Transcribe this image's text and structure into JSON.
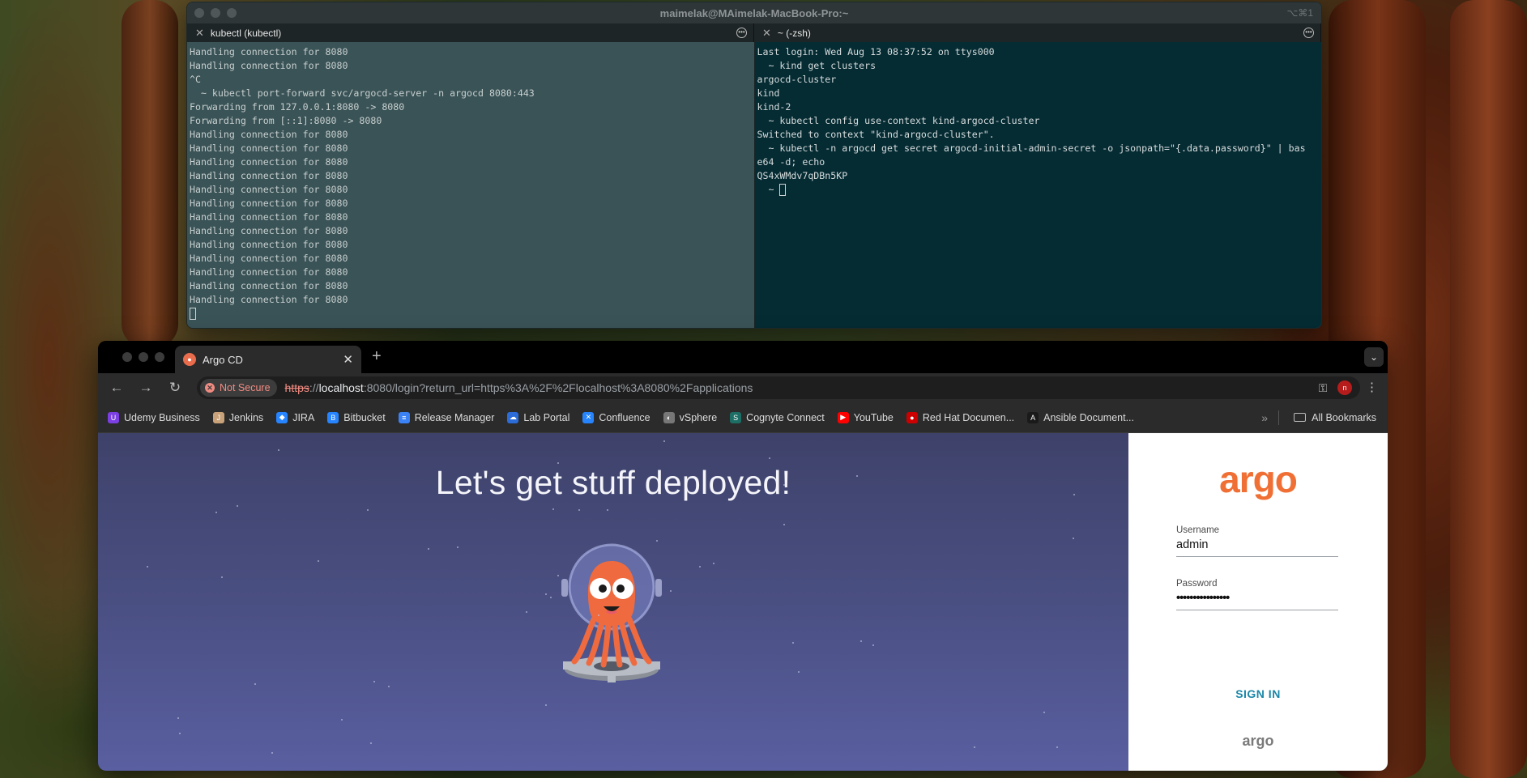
{
  "terminal": {
    "window_title": "maimelak@MAimelak-MacBook-Pro:~",
    "shortcut": "⌥⌘1",
    "tabs": [
      {
        "label": "kubectl (kubectl)"
      },
      {
        "label": "~ (-zsh)"
      }
    ],
    "left_lines": [
      "Handling connection for 8080",
      "Handling connection for 8080",
      "^C",
      "  ~ kubectl port-forward svc/argocd-server -n argocd 8080:443",
      "Forwarding from 127.0.0.1:8080 -> 8080",
      "Forwarding from [::1]:8080 -> 8080",
      "Handling connection for 8080",
      "Handling connection for 8080",
      "Handling connection for 8080",
      "Handling connection for 8080",
      "Handling connection for 8080",
      "Handling connection for 8080",
      "Handling connection for 8080",
      "Handling connection for 8080",
      "Handling connection for 8080",
      "Handling connection for 8080",
      "Handling connection for 8080",
      "Handling connection for 8080",
      "Handling connection for 8080"
    ],
    "right_lines": [
      "Last login: Wed Aug 13 08:37:52 on ttys000",
      "  ~ kind get clusters",
      "argocd-cluster",
      "kind",
      "kind-2",
      "  ~ kubectl config use-context kind-argocd-cluster",
      "Switched to context \"kind-argocd-cluster\".",
      "  ~ kubectl -n argocd get secret argocd-initial-admin-secret -o jsonpath=\"{.data.password}\" | bas",
      "e64 -d; echo",
      "QS4xWMdv7qDBn5KP",
      "  ~ "
    ]
  },
  "browser": {
    "tab_title": "Argo CD",
    "security_label": "Not Secure",
    "url_scheme": "https",
    "url_sep": "://",
    "url_host": "localhost",
    "url_rest": ":8080/login?return_url=https%3A%2F%2Flocalhost%3A8080%2Fapplications",
    "profile_initial": "n",
    "bookmarks": [
      {
        "label": "Udemy Business",
        "color": "#7b3fe4",
        "glyph": "U"
      },
      {
        "label": "Jenkins",
        "color": "#c9a27a",
        "glyph": "J"
      },
      {
        "label": "JIRA",
        "color": "#2684ff",
        "glyph": "◆"
      },
      {
        "label": "Bitbucket",
        "color": "#2684ff",
        "glyph": "B"
      },
      {
        "label": "Release Manager",
        "color": "#3b82f6",
        "glyph": "≡"
      },
      {
        "label": "Lab Portal",
        "color": "#2b6cd9",
        "glyph": "☁"
      },
      {
        "label": "Confluence",
        "color": "#2684ff",
        "glyph": "✕"
      },
      {
        "label": "vSphere",
        "color": "#777777",
        "glyph": "◐"
      },
      {
        "label": "Cognyte Connect",
        "color": "#1d6e64",
        "glyph": "S"
      },
      {
        "label": "YouTube",
        "color": "#ff0000",
        "glyph": "▶"
      },
      {
        "label": "Red Hat Documen...",
        "color": "#cc0000",
        "glyph": "●"
      },
      {
        "label": "Ansible Document...",
        "color": "#1a1a1a",
        "glyph": "A"
      }
    ],
    "all_bookmarks": "All Bookmarks"
  },
  "page": {
    "hero_title": "Let's get stuff deployed!",
    "logo_text": "argo",
    "username_label": "Username",
    "username_value": "admin",
    "password_label": "Password",
    "password_value": "••••••••••••••••",
    "signin_label": "SIGN IN",
    "footer_logo": "argo"
  },
  "colors": {
    "argo_orange": "#f06f34",
    "signin_teal": "#1a87a8",
    "hero_bg": "#4a4f82",
    "not_secure_red": "#f28b82"
  }
}
